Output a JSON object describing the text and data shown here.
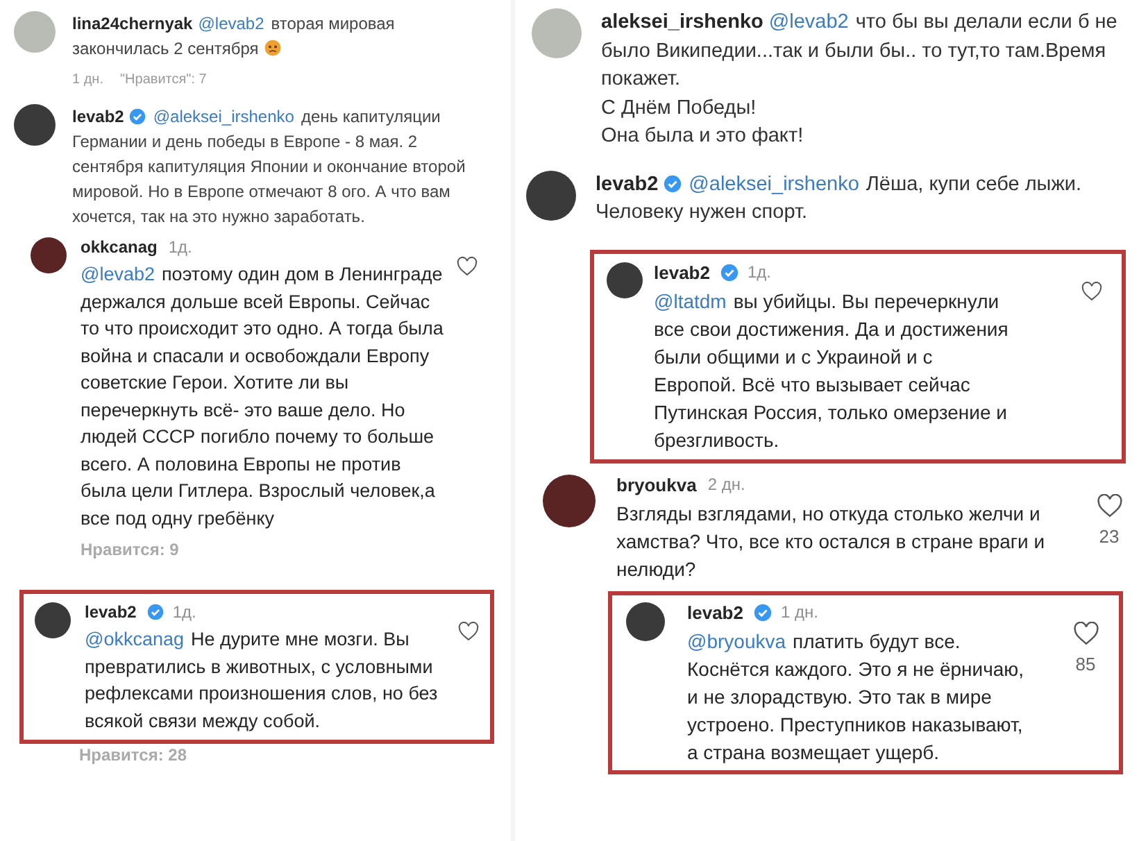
{
  "columns": [
    {
      "comments": [
        {
          "username": "lina24chernyak",
          "mention": "@levab2",
          "text": "вторая мировая закончилась 2 сентября",
          "emoji": true,
          "meta": [
            "1 дн.",
            "\"Нравится\": 7"
          ]
        },
        {
          "username": "levab2",
          "verified": true,
          "mention": "@aleksei_irshenko",
          "text": "день капитуляции Германии и день победы в Европе - 8 мая. 2 сентября капитуляция Японии и окончание второй мировой. Но в Европе отмечают 8 ого. А что вам хочется, так на это нужно заработать."
        },
        {
          "username": "okkcanag",
          "time": "1д.",
          "heart": true,
          "mention": "@levab2",
          "text": "поэтому один дом в Ленинграде держался дольше всей Европы. Сейчас то что происходит это одно. А тогда была война и спасали и освобождали Европу советские Герои. Хотите ли вы перечеркнуть всё- это ваше дело. Но людей СССР погибло почему то больше всего. А половина Европы не против была цели Гитлера. Взрослый человек,а все под одну гребёнку",
          "meta": [
            "Нравится: 9"
          ]
        },
        {
          "username": "levab2",
          "time": "1д.",
          "verified": true,
          "highlighted": true,
          "heart": true,
          "mention": "@okkcanag",
          "text": "Не дурите мне мозги. Вы превратились в животных, с условными рефлексами произношения слов, но без всякой связи между собой.",
          "meta": [
            "Нравится: 28"
          ]
        }
      ]
    },
    {
      "comments": [
        {
          "username": "aleksei_irshenko",
          "mention": "@levab2",
          "text": "что бы вы делали если б не было Википедии...так и были бы.. то тут,то там.Время покажет.\nС Днём Победы!\nОна была и это факт!"
        },
        {
          "username": "levab2",
          "verified": true,
          "mention": "@aleksei_irshenko",
          "text": "Лёша, купи себе лыжи. Человеку нужен спорт."
        },
        {
          "username": "levab2",
          "time": "1д.",
          "verified": true,
          "highlighted": true,
          "heart": true,
          "mention": "@ltatdm",
          "text": "вы убийцы. Вы перечеркнули все свои достижения. Да и достижения были общими и с Украиной и с Европой. Всё что вызывает сейчас Путинская Россия, только омерзение и брезгливость."
        },
        {
          "username": "bryoukva",
          "time": "2 дн.",
          "heart": true,
          "likes": "23",
          "text": "Взгляды взглядами, но откуда столько желчи и хамства? Что, все кто остался в стране враги и нелюди?"
        },
        {
          "username": "levab2",
          "time": "1 дн.",
          "verified": true,
          "highlighted": true,
          "heart": true,
          "likes": "85",
          "mention": "@bryoukva",
          "text": "платить будут все. Коснётся каждого. Это я не ёрничаю, и не злорадствую. Это так в мире устроено. Преступников наказывают, а страна возмещает ущерб."
        }
      ]
    }
  ]
}
